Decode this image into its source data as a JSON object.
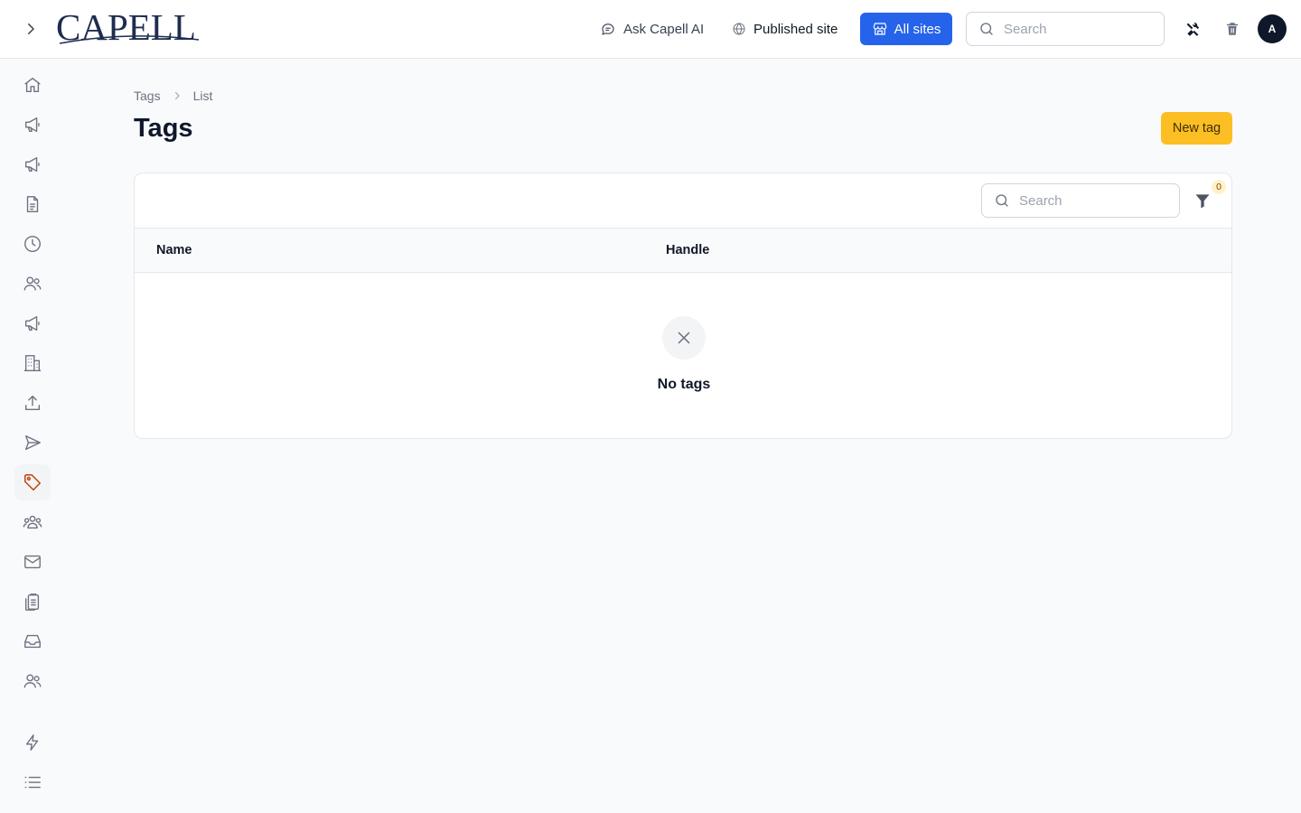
{
  "app": {
    "brand": "CAPELL"
  },
  "header": {
    "ask_ai_label": "Ask Capell AI",
    "published_site_label": "Published site",
    "all_sites_label": "All sites",
    "search_placeholder": "Search",
    "avatar_initial": "A",
    "accent_color": "#2563eb"
  },
  "sidebar": {
    "active_item": "tags-icon",
    "active_color": "#c2410c",
    "items": [
      "home-icon",
      "megaphone-icon",
      "megaphone-icon",
      "document-icon",
      "clock-icon",
      "users-icon",
      "megaphone-icon",
      "building-icon",
      "upload-icon",
      "send-icon",
      "tags-icon",
      "user-group-icon",
      "envelope-icon",
      "clipboard-icon",
      "inbox-icon",
      "users-icon",
      "bolt-icon",
      "list-icon"
    ]
  },
  "breadcrumb": {
    "parent": "Tags",
    "current": "List"
  },
  "page": {
    "title": "Tags",
    "new_button_label": "New tag",
    "new_button_color": "#fbbf24"
  },
  "table": {
    "search_placeholder": "Search",
    "filter_count": "0",
    "columns": [
      "Name",
      "Handle"
    ],
    "rows": [],
    "empty_state": "No tags"
  }
}
